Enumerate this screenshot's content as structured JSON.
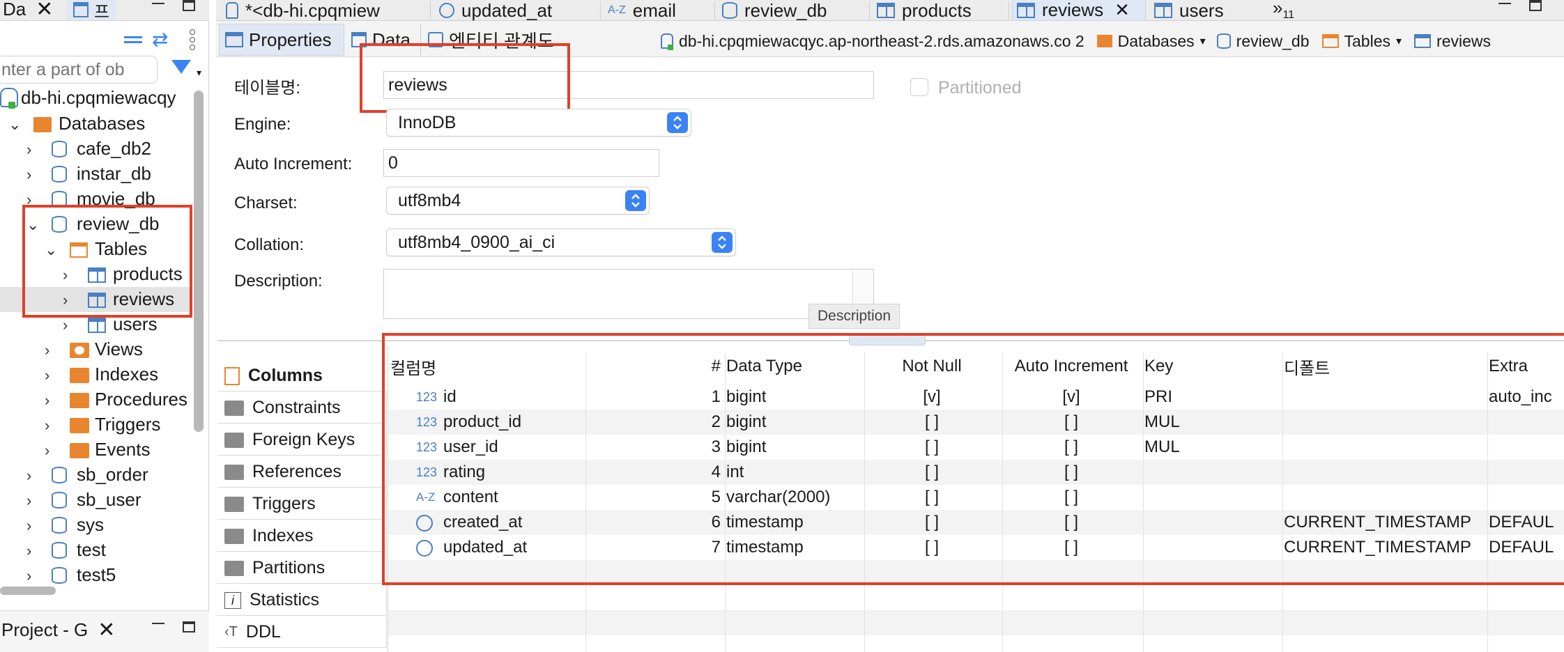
{
  "left_panel": {
    "tab_label": "Da",
    "tab2_label": "프",
    "filter_placeholder": "nter a part of ob",
    "connection_label": "db-hi.cpqmiewacqy",
    "tree": [
      {
        "label": "Databases",
        "indent": 0,
        "expanded": true,
        "icon": "folder-db-icon"
      },
      {
        "label": "cafe_db2",
        "indent": 1,
        "icon": "database-icon"
      },
      {
        "label": "instar_db",
        "indent": 1,
        "icon": "database-icon"
      },
      {
        "label": "movie_db",
        "indent": 1,
        "icon": "database-icon"
      },
      {
        "label": "review_db",
        "indent": 1,
        "expanded": true,
        "icon": "database-icon"
      },
      {
        "label": "Tables",
        "indent": 2,
        "expanded": true,
        "icon": "tables-icon"
      },
      {
        "label": "products",
        "indent": 3,
        "icon": "table-icon"
      },
      {
        "label": "reviews",
        "indent": 3,
        "icon": "table-icon",
        "selected": true
      },
      {
        "label": "users",
        "indent": 3,
        "icon": "table-icon"
      },
      {
        "label": "Views",
        "indent": 2,
        "icon": "views-icon"
      },
      {
        "label": "Indexes",
        "indent": 2,
        "icon": "folder-icon"
      },
      {
        "label": "Procedures",
        "indent": 2,
        "icon": "folder-icon"
      },
      {
        "label": "Triggers",
        "indent": 2,
        "icon": "folder-icon"
      },
      {
        "label": "Events",
        "indent": 2,
        "icon": "folder-icon"
      },
      {
        "label": "sb_order",
        "indent": 1,
        "icon": "database-icon"
      },
      {
        "label": "sb_user",
        "indent": 1,
        "icon": "database-icon"
      },
      {
        "label": "sys",
        "indent": 1,
        "icon": "database-icon"
      },
      {
        "label": "test",
        "indent": 1,
        "icon": "database-icon"
      },
      {
        "label": "test5",
        "indent": 1,
        "icon": "database-icon"
      }
    ],
    "bottom_tab_label": "Project - G"
  },
  "editor_tabs": [
    {
      "label": "*<db-hi.cpqmiew",
      "icon": "connection-icon"
    },
    {
      "label": "updated_at",
      "icon": "clock-icon"
    },
    {
      "label": "email",
      "icon": "az-icon"
    },
    {
      "label": "review_db",
      "icon": "database-icon"
    },
    {
      "label": "products",
      "icon": "table-icon"
    },
    {
      "label": "reviews",
      "icon": "table-icon",
      "active": true
    },
    {
      "label": "users",
      "icon": "table-icon"
    }
  ],
  "overflow_count": "11",
  "subtabs": {
    "properties": "Properties",
    "data": "Data",
    "er": "엔티티 관계도"
  },
  "breadcrumb": {
    "connection": "db-hi.cpqmiewacqyc.ap-northeast-2.rds.amazonaws.co 2",
    "databases": "Databases",
    "database": "review_db",
    "tables": "Tables",
    "table": "reviews"
  },
  "form": {
    "table_name_label": "테이블명:",
    "table_name": "reviews",
    "partitioned_label": "Partitioned",
    "engine_label": "Engine:",
    "engine": "InnoDB",
    "auto_increment_label": "Auto Increment:",
    "auto_increment": "0",
    "charset_label": "Charset:",
    "charset": "utf8mb4",
    "collation_label": "Collation:",
    "collation": "utf8mb4_0900_ai_ci",
    "description_label": "Description:",
    "description_tooltip": "Description"
  },
  "side_tabs": [
    "Columns",
    "Constraints",
    "Foreign Keys",
    "References",
    "Triggers",
    "Indexes",
    "Partitions",
    "Statistics",
    "DDL"
  ],
  "columns_table": {
    "headers": [
      "컬럼명",
      "#",
      "Data Type",
      "Not Null",
      "Auto Increment",
      "Key",
      "디폴트",
      "Extra"
    ],
    "rows": [
      {
        "icon": "123",
        "name": "id",
        "num": "1",
        "type": "bigint",
        "not_null": "[v]",
        "auto_inc": "[v]",
        "key": "PRI",
        "default": "",
        "extra": "auto_inc"
      },
      {
        "icon": "123",
        "name": "product_id",
        "num": "2",
        "type": "bigint",
        "not_null": "[ ]",
        "auto_inc": "[ ]",
        "key": "MUL",
        "default": "",
        "extra": ""
      },
      {
        "icon": "123",
        "name": "user_id",
        "num": "3",
        "type": "bigint",
        "not_null": "[ ]",
        "auto_inc": "[ ]",
        "key": "MUL",
        "default": "",
        "extra": ""
      },
      {
        "icon": "123",
        "name": "rating",
        "num": "4",
        "type": "int",
        "not_null": "[ ]",
        "auto_inc": "[ ]",
        "key": "",
        "default": "",
        "extra": ""
      },
      {
        "icon": "A-Z",
        "name": "content",
        "num": "5",
        "type": "varchar(2000)",
        "not_null": "[ ]",
        "auto_inc": "[ ]",
        "key": "",
        "default": "",
        "extra": ""
      },
      {
        "icon": "clock",
        "name": "created_at",
        "num": "6",
        "type": "timestamp",
        "not_null": "[ ]",
        "auto_inc": "[ ]",
        "key": "",
        "default": "CURRENT_TIMESTAMP",
        "extra": "DEFAUL"
      },
      {
        "icon": "clock",
        "name": "updated_at",
        "num": "7",
        "type": "timestamp",
        "not_null": "[ ]",
        "auto_inc": "[ ]",
        "key": "",
        "default": "CURRENT_TIMESTAMP",
        "extra": "DEFAUL"
      }
    ]
  },
  "colors": {
    "highlight_red": "#e0402a",
    "accent_blue": "#3b82f6",
    "db_blue": "#4a7fc1",
    "folder_orange": "#e8862f"
  }
}
